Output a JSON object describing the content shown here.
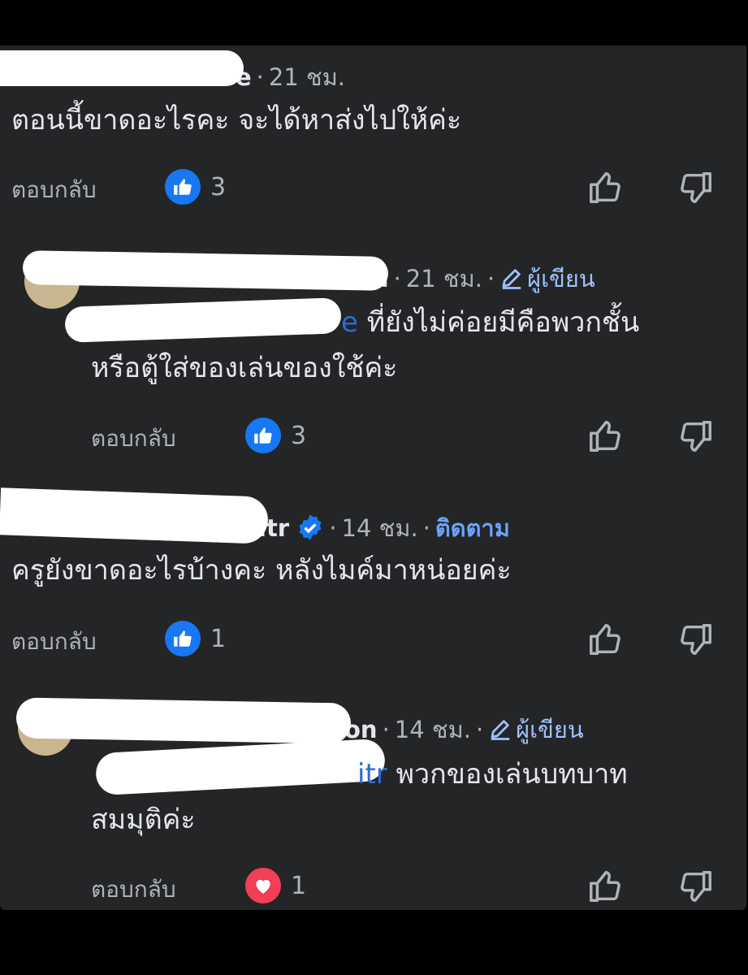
{
  "colors": {
    "background": "#242526",
    "text": "#e4e6eb",
    "muted": "#b0b3b8",
    "link": "#6aa4ff",
    "like": "#1877f2",
    "love": "#f33e58"
  },
  "comments": [
    {
      "name_tail": "e",
      "time": "21 ชม.",
      "text": "ตอนนี้ขาดอะไรคะ จะได้หาส่งไปให้ค่ะ",
      "reply_label": "ตอบกลับ",
      "reaction": "like-icon",
      "count": "3"
    },
    {
      "name_tail": "on",
      "time": "21 ชม.",
      "badge": "ผู้เขียน",
      "mention_tail": "e",
      "text_line1": "ที่ยังไม่ค่อยมีคือพวกชั้น",
      "text_line2": "หรือตู้ใส่ของเล่นของใช้ค่ะ",
      "reply_label": "ตอบกลับ",
      "reaction": "like-icon",
      "count": "3"
    },
    {
      "name_tail": "itr",
      "time": "14 ชม.",
      "follow": "ติดตาม",
      "text": "ครูยังขาดอะไรบ้างคะ หลังไมค์มาหน่อยค่ะ",
      "reply_label": "ตอบกลับ",
      "reaction": "like-icon",
      "count": "1"
    },
    {
      "name_tail": "on",
      "time": "14 ชม.",
      "badge": "ผู้เขียน",
      "mention_tail": "itr",
      "text_line1": "พวกของเล่นบทบาท",
      "text_line2": "สมมุติค่ะ",
      "reply_label": "ตอบกลับ",
      "reaction": "heart-icon",
      "count": "1"
    }
  ]
}
